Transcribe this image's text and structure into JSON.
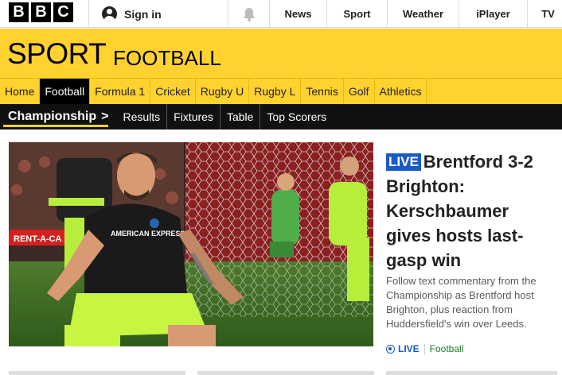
{
  "masthead": {
    "logo_letters": [
      "B",
      "B",
      "C"
    ],
    "signin_label": "Sign in",
    "nav": [
      "News",
      "Sport",
      "Weather",
      "iPlayer",
      "TV"
    ]
  },
  "header": {
    "title": "SPORT",
    "subtitle": "FOOTBALL"
  },
  "sports_nav": {
    "items": [
      "Home",
      "Football",
      "Formula 1",
      "Cricket",
      "Rugby U",
      "Rugby L",
      "Tennis",
      "Golf",
      "Athletics"
    ],
    "active": "Football"
  },
  "sub_nav": {
    "current": "Championship",
    "chevron": ">",
    "links": [
      "Results",
      "Fixtures",
      "Table",
      "Top Scorers"
    ]
  },
  "story": {
    "live_badge": "LIVE",
    "headline": "Brentford 3-2 Brighton: Kerschbaumer gives hosts last-gasp win",
    "summary": "Follow text commentary from the Championship as Brentford host Brighton, plus reaction from Huddersfield's win over Leeds.",
    "meta_live": "LIVE",
    "meta_section": "Football",
    "image_shirt_text": "AMERICAN EXPRESS",
    "image_board_text": "RENT-A-CA"
  },
  "colors": {
    "sport_yellow": "#ffd230",
    "live_blue": "#1a5ac6",
    "section_green": "#1a7a2c"
  }
}
